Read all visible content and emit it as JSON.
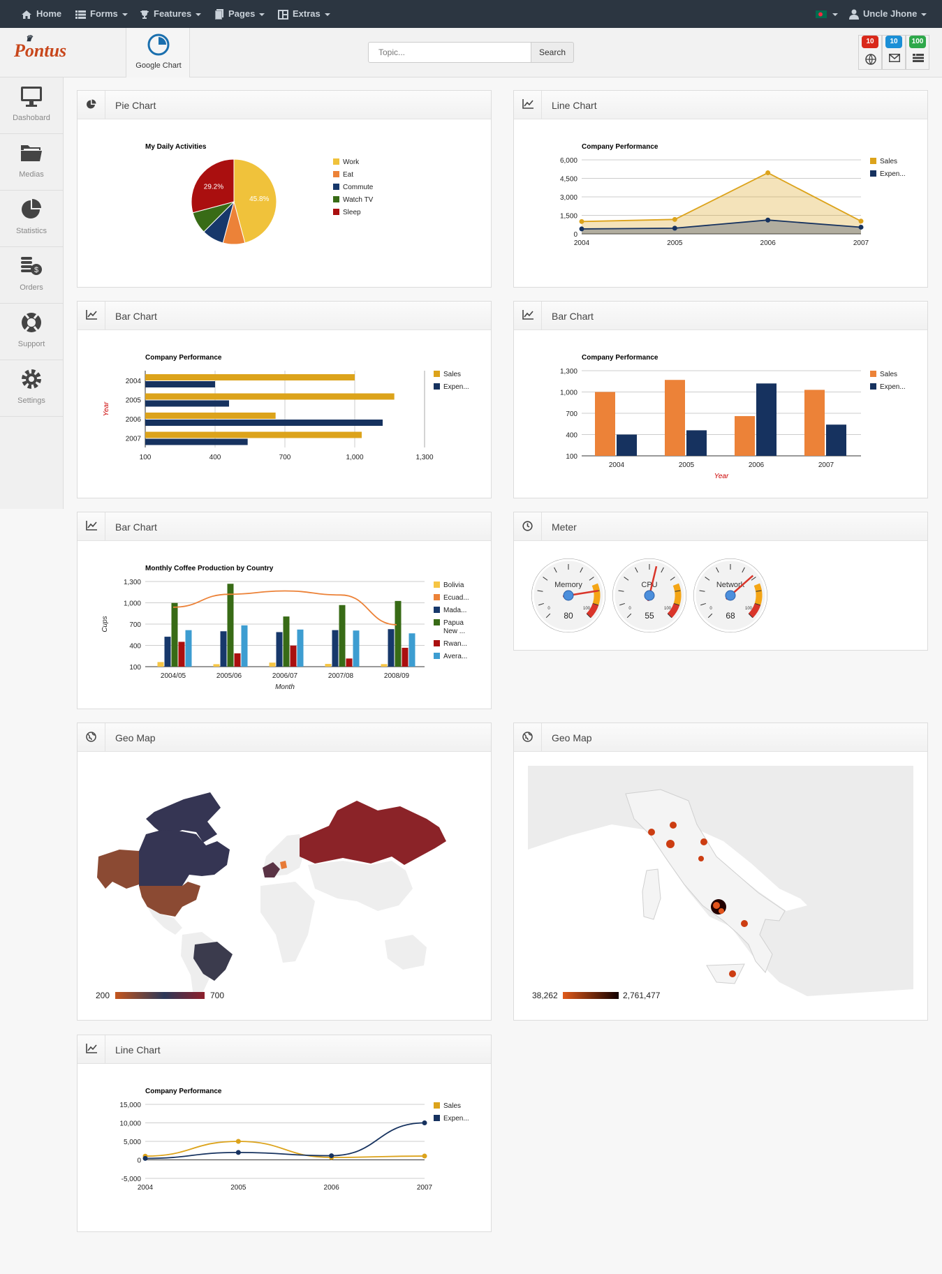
{
  "nav": {
    "home": "Home",
    "forms": "Forms",
    "features": "Features",
    "pages": "Pages",
    "extras": "Extras",
    "user": "Uncle Jhone"
  },
  "header": {
    "logo": "Pontus",
    "tab_label": "Google Chart",
    "search_placeholder": "Topic...",
    "search_button": "Search",
    "notifications": [
      {
        "count": "10",
        "color": "#d9281a",
        "icon": "globe-icon"
      },
      {
        "count": "10",
        "color": "#1b8fd6",
        "icon": "envelope-icon"
      },
      {
        "count": "100",
        "color": "#2ea84a",
        "icon": "list-icon"
      }
    ]
  },
  "sidebar": {
    "items": [
      {
        "label": "Dashobard",
        "icon": "monitor-icon"
      },
      {
        "label": "Medias",
        "icon": "folder-icon"
      },
      {
        "label": "Statistics",
        "icon": "pie-icon"
      },
      {
        "label": "Orders",
        "icon": "coins-icon"
      },
      {
        "label": "Support",
        "icon": "lifebuoy-icon"
      },
      {
        "label": "Settings",
        "icon": "gear-icon"
      }
    ]
  },
  "panels": {
    "pie": {
      "title": "Pie Chart"
    },
    "line1": {
      "title": "Line Chart"
    },
    "bar1": {
      "title": "Bar Chart"
    },
    "bar2": {
      "title": "Bar Chart"
    },
    "bar3": {
      "title": "Bar Chart"
    },
    "meter": {
      "title": "Meter"
    },
    "geo1": {
      "title": "Geo Map"
    },
    "geo2": {
      "title": "Geo Map"
    },
    "line2": {
      "title": "Line Chart"
    }
  },
  "colors": {
    "sales": "#dca31b",
    "expenses": "#16325f",
    "orange": "#ec8238"
  },
  "chart_data": [
    {
      "id": "pie",
      "type": "pie",
      "title": "My Daily Activities",
      "categories": [
        "Work",
        "Eat",
        "Commute",
        "Watch TV",
        "Sleep"
      ],
      "values": [
        11,
        2,
        2,
        2,
        7
      ],
      "slice_labels": [
        "45.8%",
        "",
        "",
        "",
        "29.2%"
      ],
      "colors": [
        "#f0c23b",
        "#ec8238",
        "#17386b",
        "#386b16",
        "#aa0f0f"
      ]
    },
    {
      "id": "line1",
      "type": "area",
      "title": "Company Performance",
      "categories": [
        "2004",
        "2005",
        "2006",
        "2007"
      ],
      "yticks": [
        "0",
        "1,500",
        "3,000",
        "4,500",
        "6,000"
      ],
      "ylim": [
        0,
        6000
      ],
      "series": [
        {
          "name": "Sales",
          "values": [
            1000,
            1170,
            4950,
            1030
          ]
        },
        {
          "name": "Expen...",
          "values": [
            400,
            460,
            1120,
            540
          ]
        }
      ]
    },
    {
      "id": "bar1",
      "type": "bar",
      "orientation": "horizontal",
      "title": "Company Performance",
      "ylabel": "Year",
      "categories": [
        "2004",
        "2005",
        "2006",
        "2007"
      ],
      "xticks": [
        "100",
        "400",
        "700",
        "1,000",
        "1,300"
      ],
      "xlim": [
        100,
        1300
      ],
      "series": [
        {
          "name": "Sales",
          "values": [
            1000,
            1170,
            660,
            1030
          ]
        },
        {
          "name": "Expen...",
          "values": [
            400,
            460,
            1120,
            540
          ]
        }
      ]
    },
    {
      "id": "bar2",
      "type": "bar",
      "orientation": "vertical",
      "title": "Company Performance",
      "xlabel": "Year",
      "categories": [
        "2004",
        "2005",
        "2006",
        "2007"
      ],
      "yticks": [
        "100",
        "400",
        "700",
        "1,000",
        "1,300"
      ],
      "ylim": [
        100,
        1300
      ],
      "series": [
        {
          "name": "Sales",
          "values": [
            1000,
            1170,
            660,
            1030
          ]
        },
        {
          "name": "Expen...",
          "values": [
            400,
            460,
            1120,
            540
          ]
        }
      ]
    },
    {
      "id": "bar3",
      "type": "bar",
      "orientation": "vertical",
      "title": "Monthly Coffee Production by Country",
      "xlabel": "Month",
      "ylabel": "Cups",
      "categories": [
        "2004/05",
        "2005/06",
        "2006/07",
        "2007/08",
        "2008/09"
      ],
      "yticks": [
        "100",
        "400",
        "700",
        "1,000",
        "1,300"
      ],
      "ylim": [
        100,
        1300
      ],
      "series": [
        {
          "name": "Bolivia",
          "values": [
            165,
            135,
            157,
            139,
            136
          ]
        },
        {
          "name": "Ecuad...",
          "values": [
            938,
            1120,
            1167,
            1110,
            691
          ]
        },
        {
          "name": "Mada...",
          "values": [
            522,
            599,
            587,
            615,
            629
          ]
        },
        {
          "name": "Papua New ...",
          "values": [
            998,
            1268,
            807,
            968,
            1026
          ]
        },
        {
          "name": "Rwan...",
          "values": [
            450,
            288,
            397,
            215,
            366
          ]
        },
        {
          "name": "Avera...",
          "values": [
            614.6,
            682,
            623,
            609.4,
            569.6
          ]
        }
      ],
      "line_series": "Ecuad...",
      "colors": [
        "#f6c544",
        "#ec8238",
        "#17386b",
        "#386b16",
        "#aa0f0f",
        "#3d9dd1"
      ]
    },
    {
      "id": "meter",
      "type": "gauge",
      "gauges": [
        {
          "name": "Memory",
          "value": 80
        },
        {
          "name": "CPU",
          "value": 55
        },
        {
          "name": "Network",
          "value": 68
        }
      ],
      "tick_min": "0",
      "tick_max": "100"
    },
    {
      "id": "geo1",
      "type": "geo",
      "range_min": "200",
      "range_max": "700"
    },
    {
      "id": "geo2",
      "type": "geo",
      "range_min": "38,262",
      "range_max": "2,761,477"
    },
    {
      "id": "line2",
      "type": "line",
      "title": "Company Performance",
      "categories": [
        "2004",
        "2005",
        "2006",
        "2007"
      ],
      "yticks": [
        "-5,000",
        "0",
        "5,000",
        "10,000",
        "15,000"
      ],
      "ylim": [
        -5000,
        15000
      ],
      "series": [
        {
          "name": "Sales",
          "values": [
            1000,
            5000,
            660,
            1030
          ]
        },
        {
          "name": "Expen...",
          "values": [
            400,
            2000,
            1120,
            10000
          ]
        }
      ]
    }
  ]
}
